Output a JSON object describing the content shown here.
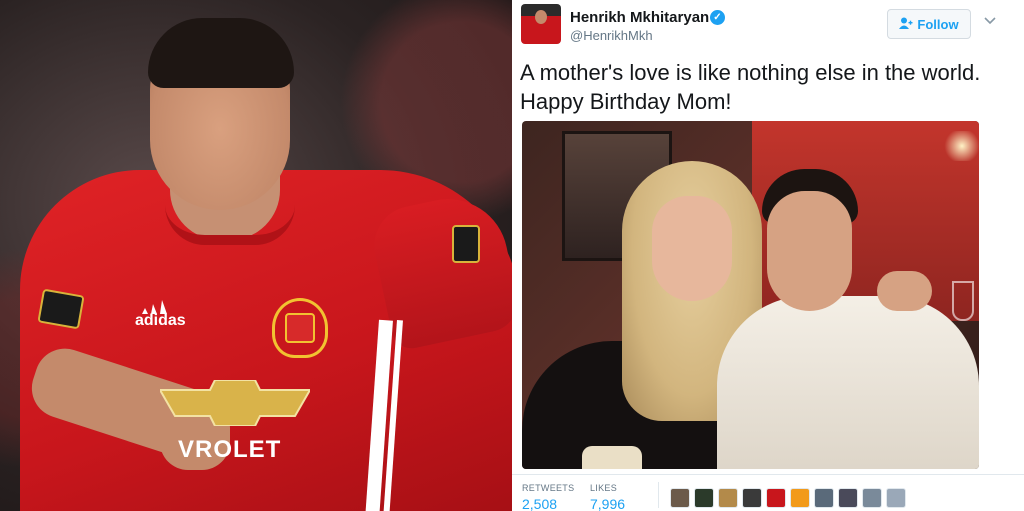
{
  "tweet": {
    "display_name": "Henrikh Mkhitaryan",
    "handle": "@HenrikhMkh",
    "follow_label": "Follow",
    "text": "A mother's love is like nothing else in the world.\nHappy Birthday Mom!",
    "verified_icon": "verified-checkmark-icon",
    "chevron_icon": "chevron-down-icon",
    "follow_icon": "add-user-icon",
    "stats": {
      "retweets_label": "RETWEETS",
      "retweets_value": "2,508",
      "likes_label": "LIKES",
      "likes_value": "7,996"
    },
    "liker_colors": [
      "#6b5a4a",
      "#2b3a2a",
      "#b38a4a",
      "#3a3a3a",
      "#c8161c",
      "#f29a1a",
      "#5a6a7a",
      "#4a4a5a",
      "#7a8a9a",
      "#9aa8b8"
    ]
  },
  "colors": {
    "accent": "#1da1f2",
    "text": "#14171a",
    "secondary_text": "#657786"
  },
  "left_photo": {
    "sponsor_text": "VROLET",
    "brand_text": "adidas"
  }
}
